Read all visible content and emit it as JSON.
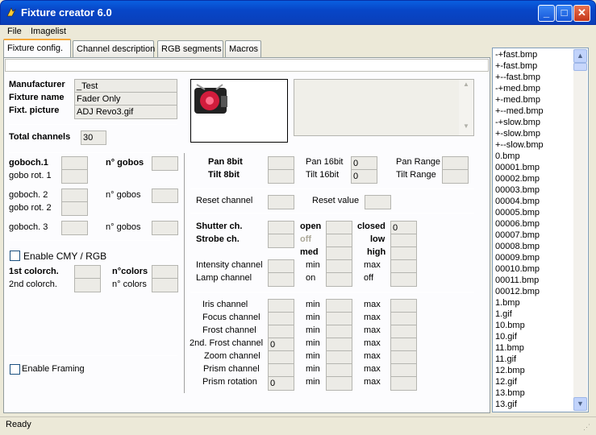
{
  "window": {
    "title": "Fixture creator 6.0",
    "min_label": "_",
    "max_label": "□",
    "close_label": "✕"
  },
  "menu": {
    "file": "File",
    "imagelist": "Imagelist"
  },
  "tabs": {
    "fixture_config": "Fixture config.",
    "channel_description": "Channel description",
    "rgb_segments": "RGB segments",
    "macros": "Macros"
  },
  "fixture": {
    "manufacturer_label": "Manufacturer",
    "manufacturer_value": "_Test",
    "name_label": "Fixture name",
    "name_value": "Fader Only",
    "picture_label": "Fixt. picture",
    "picture_value": "ADJ Revo3.gif",
    "total_channels_label": "Total channels",
    "total_channels_value": "30"
  },
  "gobo": {
    "goboch1": "goboch.1",
    "nr_gobos_bold": "n° gobos",
    "gobo_rot1": "gobo rot. 1",
    "goboch2": "goboch. 2",
    "nr_gobos2": "n° gobos",
    "gobo_rot2": "gobo rot. 2",
    "goboch3": "goboch. 3",
    "nr_gobos3": "n° gobos"
  },
  "color": {
    "enable_cmy": "Enable CMY / RGB",
    "first_colorch": "1st colorch.",
    "ncolors_bold": "n°colors",
    "second_colorch": "2nd colorch.",
    "ncolors2": "n° colors",
    "enable_framing": "Enable Framing"
  },
  "pantilt": {
    "pan8": "Pan 8bit",
    "tilt8": "Tilt 8bit",
    "pan16": "Pan 16bit",
    "pan16_value": "0",
    "tilt16": "Tilt 16bit",
    "tilt16_value": "0",
    "pan_range": "Pan Range",
    "tilt_range": "Tilt Range"
  },
  "reset": {
    "channel": "Reset channel",
    "value": "Reset value"
  },
  "shutter": {
    "shutter_ch": "Shutter ch.",
    "strobe_ch": "Strobe ch.",
    "open": "open",
    "closed": "closed",
    "closed_value": "0",
    "off": "off",
    "low": "low",
    "med": "med",
    "high": "high",
    "intensity": "Intensity channel",
    "lamp": "Lamp channel",
    "min": "min",
    "max": "max",
    "on": "on",
    "off2": "off"
  },
  "effects": {
    "rows": [
      {
        "label": "Iris channel",
        "value": "",
        "min": "min",
        "max": "max"
      },
      {
        "label": "Focus channel",
        "value": "",
        "min": "min",
        "max": "max"
      },
      {
        "label": "Frost channel",
        "value": "",
        "min": "min",
        "max": "max"
      },
      {
        "label": "2nd. Frost channel",
        "value": "0",
        "min": "min",
        "max": "max"
      },
      {
        "label": "Zoom channel",
        "value": "",
        "min": "min",
        "max": "max"
      },
      {
        "label": "Prism channel",
        "value": "",
        "min": "min",
        "max": "max"
      },
      {
        "label": "Prism rotation",
        "value": "0",
        "min": "min",
        "max": "max"
      }
    ]
  },
  "imagelist": [
    "-+fast.bmp",
    "+-fast.bmp",
    "+--fast.bmp",
    "-+med.bmp",
    "+-med.bmp",
    "+--med.bmp",
    "-+slow.bmp",
    "+-slow.bmp",
    "+--slow.bmp",
    "0.bmp",
    "00001.bmp",
    "00002.bmp",
    "00003.bmp",
    "00004.bmp",
    "00005.bmp",
    "00006.bmp",
    "00007.bmp",
    "00008.bmp",
    "00009.bmp",
    "00010.bmp",
    "00011.bmp",
    "00012.bmp",
    "1.bmp",
    "1.gif",
    "10.bmp",
    "10.gif",
    "11.bmp",
    "11.gif",
    "12.bmp",
    "12.gif",
    "13.bmp",
    "13.gif"
  ],
  "status": "Ready",
  "colors": {
    "title_blue": "#0746c8",
    "tab_highlight": "#f5a83b",
    "close_red": "#c5371a"
  }
}
